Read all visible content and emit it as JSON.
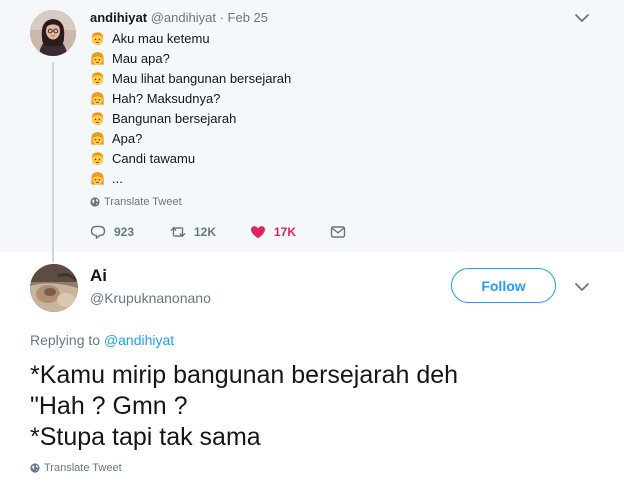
{
  "parent_tweet": {
    "display_name": "andihiyat",
    "handle": "@andihiyat",
    "separator": "·",
    "date": "Feb 25",
    "lines": [
      {
        "emoji": "person-emoji-a",
        "text": "Aku mau ketemu"
      },
      {
        "emoji": "person-emoji-b",
        "text": "Mau apa?"
      },
      {
        "emoji": "person-emoji-a",
        "text": "Mau lihat bangunan bersejarah"
      },
      {
        "emoji": "person-emoji-b",
        "text": "Hah? Maksudnya?"
      },
      {
        "emoji": "person-emoji-a",
        "text": "Bangunan bersejarah"
      },
      {
        "emoji": "person-emoji-b",
        "text": "Apa?"
      },
      {
        "emoji": "person-emoji-a",
        "text": "Candi tawamu"
      },
      {
        "emoji": "person-emoji-b",
        "text": "..."
      }
    ],
    "translate_label": "Translate Tweet",
    "reply_count": "923",
    "retweet_count": "12K",
    "like_count": "17K"
  },
  "reply_tweet": {
    "display_name": "Ai",
    "handle": "@Krupuknanonano",
    "follow_label": "Follow",
    "replying_to_label": "Replying to",
    "replying_to_handle": "@andihiyat",
    "body_lines": [
      "*Kamu mirip bangunan bersejarah deh",
      "\"Hah ? Gmn ?",
      "*Stupa tapi tak sama"
    ],
    "translate_label": "Translate Tweet"
  },
  "colors": {
    "accent": "#1da1f2",
    "like": "#e0245e",
    "muted": "#657786",
    "parent_bg": "#f5f8fa"
  }
}
